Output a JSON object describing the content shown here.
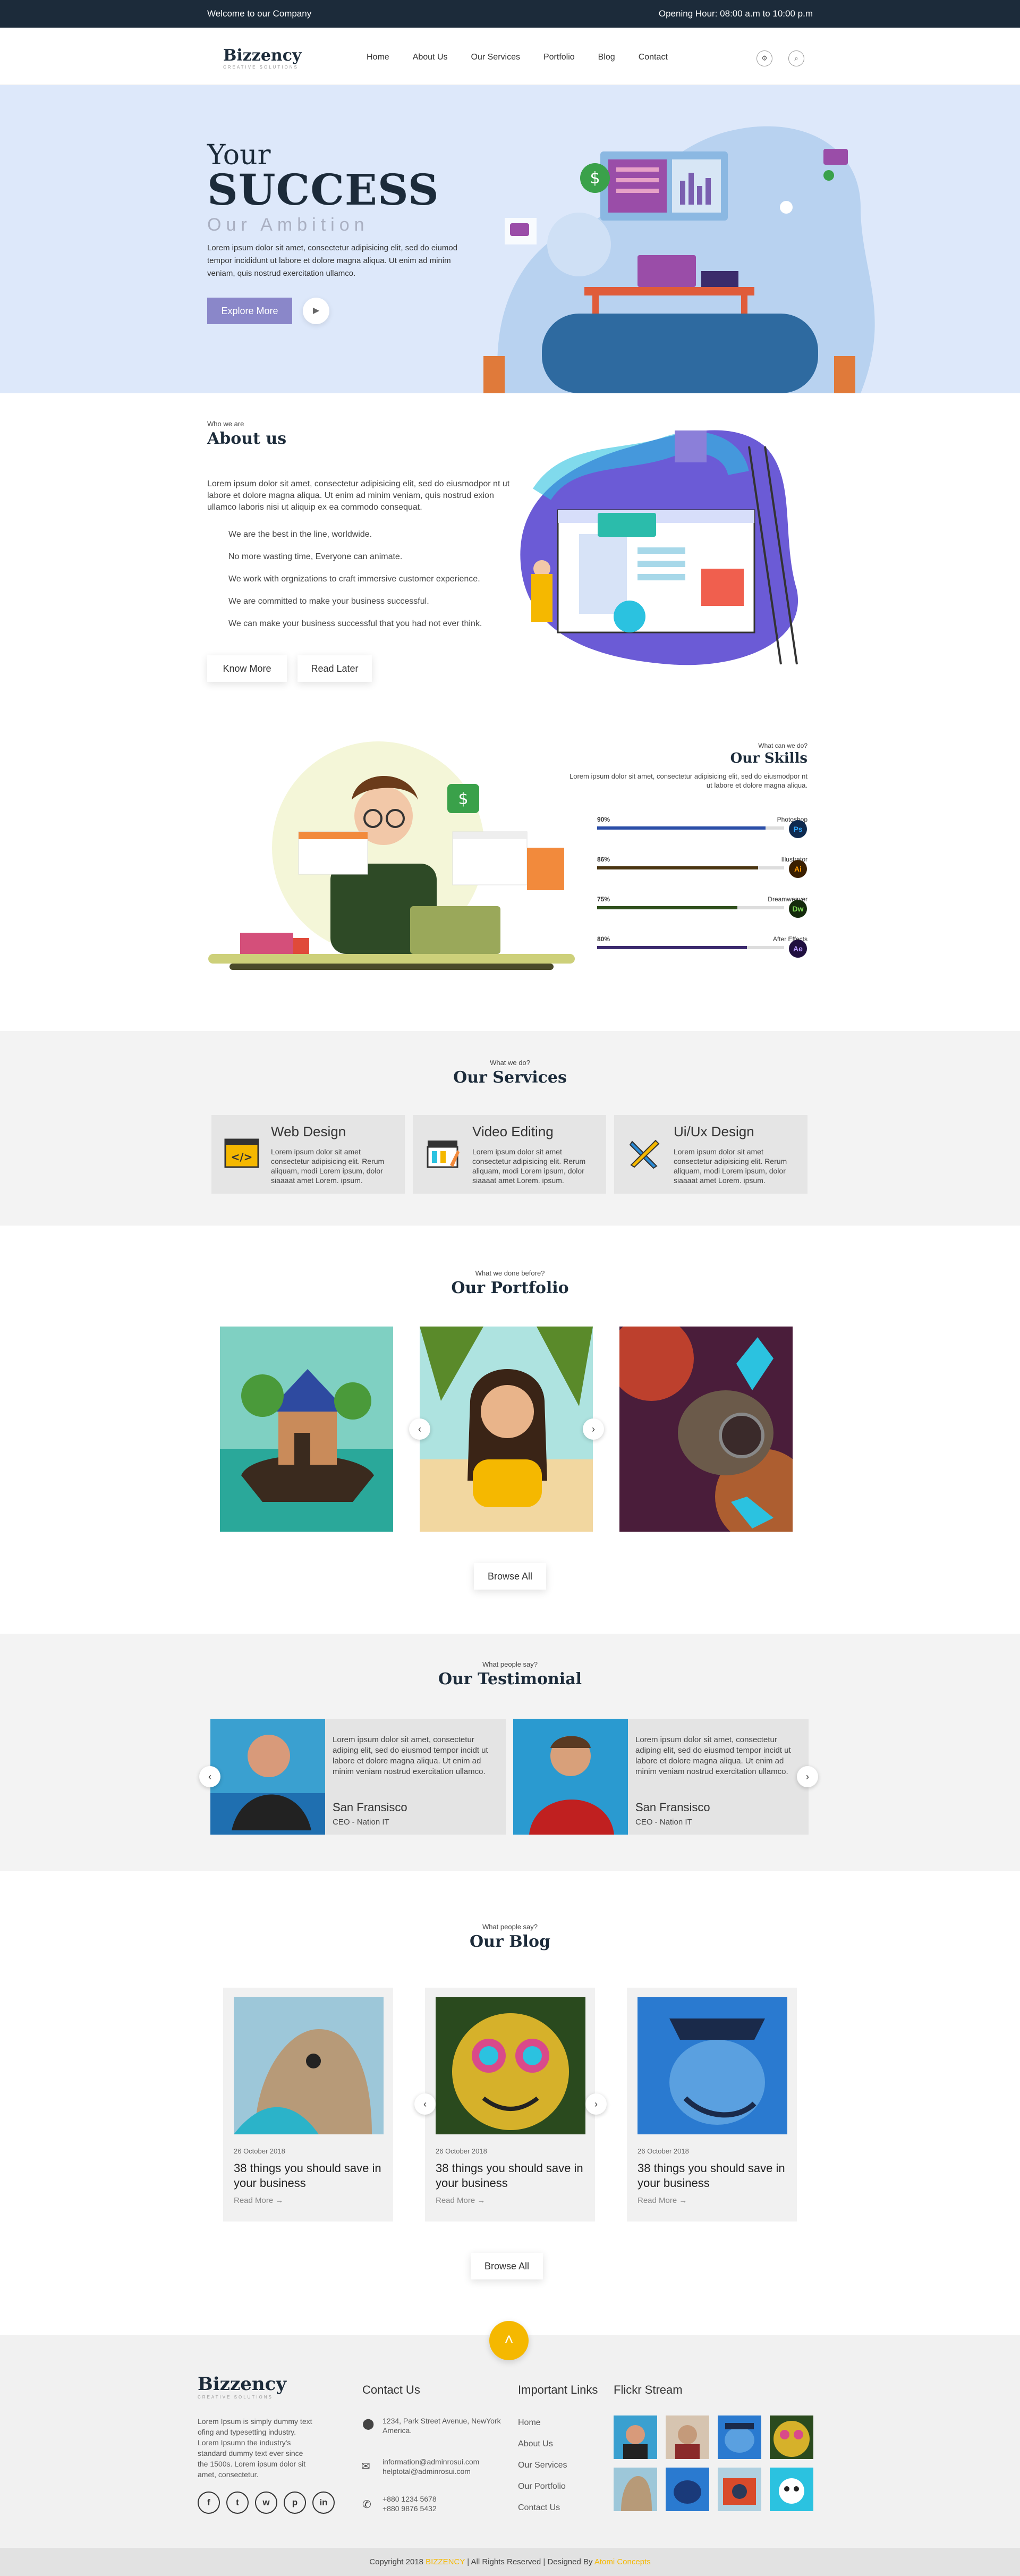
{
  "topbar": {
    "welcome": "Welcome to our Company",
    "hours": "Opening Hour: 08:00 a.m to 10:00 p.m"
  },
  "brand": {
    "name": "Bizzency",
    "tagline": "CREATIVE SOLUTIONS",
    "accent": "#f5b800",
    "dark": "#1c2b3a",
    "purple": "#8a87c9"
  },
  "nav": {
    "items": [
      "Home",
      "About Us",
      "Our Services",
      "Portfolio",
      "Blog",
      "Contact"
    ],
    "icons": [
      "gear-icon",
      "search-icon"
    ]
  },
  "hero": {
    "line1": "Your",
    "line2": "SUCCESS",
    "line3": "Our Ambition",
    "text": "Lorem ipsum dolor sit amet, consectetur adipisicing elit, sed do eiumod tempor incididunt ut labore et dolore magna aliqua. Ut enim ad minim veniam, quis nostrud exercitation ullamco.",
    "cta": "Explore More"
  },
  "about": {
    "label": "Who we are",
    "title": "About us",
    "text": "Lorem ipsum dolor sit amet, consectetur adipisicing elit, sed do eiusmodpor nt ut labore et dolore magna aliqua. Ut enim ad minim veniam, quis nostrud exion ullamco laboris nisi ut aliquip ex ea commodo consequat.",
    "points": [
      "We are the best in the line, worldwide.",
      "No more wasting time, Everyone can animate.",
      "We work with orgnizations to craft immersive customer experience.",
      "We are committed to make your business successful.",
      "We can make your business successful that you had not ever think."
    ],
    "btn1": "Know More",
    "btn2": "Read Later"
  },
  "skills": {
    "label": "What can we do?",
    "title": "Our Skills",
    "text": "Lorem ipsum dolor sit amet, consectetur adipisicing elit, sed do eiusmodpor nt ut labore et dolore magna aliqua.",
    "items": [
      {
        "pct": "90%",
        "name": "Photoshop",
        "icon": "Ps",
        "value": 0.9,
        "bar": "#2b4ea8",
        "bg": "#0e2a4f",
        "fg": "#31a8ff"
      },
      {
        "pct": "86%",
        "name": "Illustrator",
        "icon": "Ai",
        "value": 0.86,
        "bar": "#4a3512",
        "bg": "#3a1f00",
        "fg": "#ff9a00"
      },
      {
        "pct": "75%",
        "name": "Dreamweaver",
        "icon": "Dw",
        "value": 0.75,
        "bar": "#2f4f1c",
        "bg": "#142a0c",
        "fg": "#7ed957"
      },
      {
        "pct": "80%",
        "name": "After Effects",
        "icon": "Ae",
        "value": 0.8,
        "bar": "#3c2a6e",
        "bg": "#1f0f3f",
        "fg": "#b79cff"
      }
    ]
  },
  "services": {
    "label": "What we do?",
    "title": "Our Services",
    "items": [
      {
        "title": "Web Design",
        "text": "Lorem ipsum dolor sit amet consectetur adipisicing elit. Rerum aliquam, modi Lorem ipsum, dolor siaaaat amet Lorem. ipsum.",
        "icon": "code-icon"
      },
      {
        "title": "Video Editing",
        "text": "Lorem ipsum dolor sit amet consectetur adipisicing elit. Rerum aliquam, modi Lorem ipsum, dolor siaaaat amet Lorem. ipsum.",
        "icon": "clapper-icon"
      },
      {
        "title": "Ui/Ux Design",
        "text": "Lorem ipsum dolor sit amet consectetur adipisicing elit. Rerum aliquam, modi Lorem ipsum, dolor siaaaat amet Lorem. ipsum.",
        "icon": "pencil-ruler-icon"
      }
    ]
  },
  "portfolio": {
    "label": "What we done before?",
    "title": "Our Portfolio",
    "browse": "Browse All"
  },
  "testimonial": {
    "label": "What people say?",
    "title": "Our Testimonial",
    "items": [
      {
        "quote": "Lorem ipsum dolor sit amet, consectetur adiping elit, sed do eiusmod tempor incidt ut labore et dolore magna aliqua. Ut enim ad minim veniam nostrud exercitation ullamco.",
        "name": "San Fransisco",
        "role": "CEO - Nation IT"
      },
      {
        "quote": "Lorem ipsum dolor sit amet, consectetur adiping elit, sed do eiusmod tempor incidt ut labore et dolore magna aliqua. Ut enim ad minim veniam nostrud exercitation ullamco.",
        "name": "San Fransisco",
        "role": "CEO - Nation IT"
      }
    ]
  },
  "blog": {
    "label": "What people say?",
    "title": "Our Blog",
    "browse": "Browse All",
    "items": [
      {
        "date": "26 October 2018",
        "title": "38 things you should save in your business",
        "read": "Read More"
      },
      {
        "date": "26 October 2018",
        "title": "38 things you should save in your business",
        "read": "Read More"
      },
      {
        "date": "26 October 2018",
        "title": "38 things you should save in your business",
        "read": "Read More"
      }
    ]
  },
  "footer": {
    "about": "Lorem Ipsum is simply dummy text ofing and typesetting industry. Lorem Ipsumn the industry's standard dummy text ever since the 1500s. Lorem ipsum dolor sit amet, consectetur.",
    "contact_title": "Contact Us",
    "address": "1234, Park Street Avenue, NewYork America.",
    "email1": "information@adminrosui.com",
    "email2": "helptotal@adminrosui.com",
    "phone1": "+880 1234 5678",
    "phone2": "+880 9876 5432",
    "links_title": "Important Links",
    "links": [
      "Home",
      "About Us",
      "Our Services",
      "Our Portfolio",
      "Contact Us"
    ],
    "flickr_title": "Flickr Stream",
    "social": [
      "f",
      "t",
      "w",
      "p",
      "in"
    ]
  },
  "copyright": {
    "pre": "Copyright 2018 ",
    "brand": "BIZZENCY",
    "mid": "  |  All Rights Reserved  |  Designed By ",
    "designer": "Atomi Concepts"
  }
}
